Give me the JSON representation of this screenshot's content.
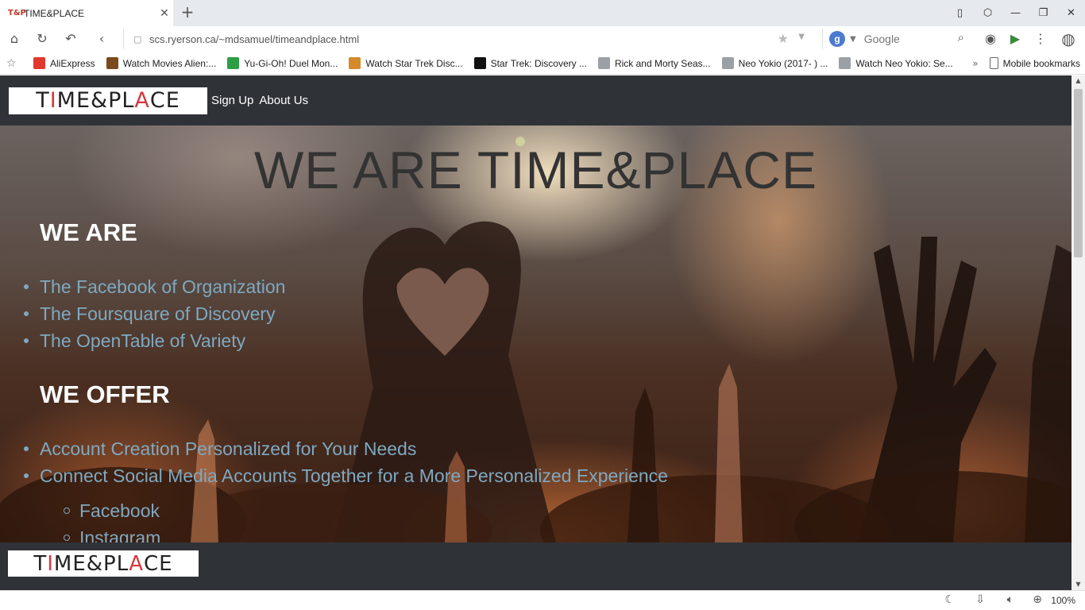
{
  "browser": {
    "tab": {
      "favicon": "T&P",
      "title": "TIME&PLACE",
      "close_icon": "close-icon"
    },
    "new_tab_icon": "plus-icon",
    "address": "scs.ryerson.ca/~mdsamuel/timeandplace.html",
    "search": {
      "engine_letter": "g",
      "placeholder": "Google"
    },
    "bookmarks": [
      {
        "label": "AliExpress",
        "color": "#e0392b"
      },
      {
        "label": "Watch Movies Alien:...",
        "color": "#7a4a1c"
      },
      {
        "label": "Yu-Gi-Oh! Duel Mon...",
        "color": "#2e9e45"
      },
      {
        "label": "Watch Star Trek Disc...",
        "color": "#d48a2a"
      },
      {
        "label": "Star Trek: Discovery ...",
        "color": "#111111"
      },
      {
        "label": "Rick and Morty Seas...",
        "color": "#9aa0a6"
      },
      {
        "label": "Neo Yokio (2017- ) ...",
        "color": "#9aa0a6"
      },
      {
        "label": "Watch Neo Yokio: Se...",
        "color": "#9aa0a6"
      }
    ],
    "bookmarks_more": "»",
    "mobile_bookmarks": "Mobile bookmarks",
    "zoom": "100%"
  },
  "site": {
    "logo": {
      "left": "T",
      "accent1": "I",
      "middle": "ME&PL",
      "accent2": "A",
      "right": "CE"
    },
    "nav": {
      "signup": "Sign Up",
      "about": "About Us"
    },
    "hero_title": "WE ARE TIME&PLACE",
    "we_are": {
      "heading": "WE ARE",
      "items": [
        "The Facebook of Organization",
        "The Foursquare of Discovery",
        "The OpenTable of Variety"
      ]
    },
    "we_offer": {
      "heading": "WE OFFER",
      "items": [
        "Account Creation Personalized for Your Needs",
        "Connect Social Media Accounts Together for a More Personalized Experience"
      ],
      "sub_items": [
        "Facebook",
        "Instagram"
      ]
    }
  }
}
